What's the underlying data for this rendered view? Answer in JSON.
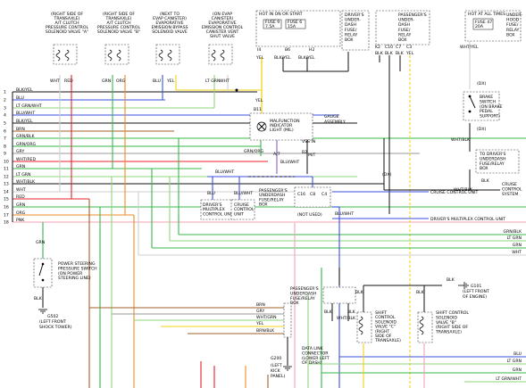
{
  "colors": {
    "red": "#e8202a",
    "yel": "#f2d214",
    "grn": "#36b84a",
    "blu": "#3a4fe0",
    "ltgrn": "#8fd67a",
    "brn": "#a0622a",
    "orange": "#f08a24",
    "pink": "#f2a2b4",
    "gray": "#9a9a9a",
    "wht": "#cfcfcf",
    "blk": "#111111",
    "purple": "#8a5fc8"
  },
  "top_components": [
    {
      "lines": [
        "(RIGHT SIDE OF",
        "TRANSAXLE)",
        "A/T CLUTCH",
        "PRESSURE CONTROL",
        "SOLENOID VALVE \"A\""
      ],
      "pins": [
        "WHT",
        "RED"
      ]
    },
    {
      "lines": [
        "(RIGHT SIDE OF",
        "TRANSAXLE)",
        "A/T CLUTCH",
        "PRESSURE CONTROL",
        "SOLENOID VALVE \"B\""
      ],
      "pins": [
        "GRN",
        "ORG"
      ]
    },
    {
      "lines": [
        "(NEXT TO",
        "EVAP CANISTER)",
        "EVAPORATIVE",
        "EMISSION BYPASS",
        "SOLENOID VALVE"
      ],
      "pins": [
        "BLU",
        "YEL"
      ]
    },
    {
      "lines": [
        "(ON EVAP",
        "CANISTER)",
        "EVAPORATIVE",
        "EMISSION CONTROL",
        "CANISTER VENT",
        "SHUT VALVE"
      ],
      "pins": [
        "LT GRN",
        "WHT"
      ]
    }
  ],
  "fuse_box_1": {
    "title": "HOT IN ON OR START",
    "fuse_a": [
      "FUSE 9",
      "7.5A"
    ],
    "fuse_b": [
      "FUSE 6",
      "15A"
    ],
    "wires": [
      "YEL",
      "BLK/YEL",
      "BLK/YEL"
    ],
    "connectors": [
      "I4",
      "B6",
      "H2"
    ]
  },
  "drivers_fuse_box": [
    "DRIVER'S",
    "UNDER-",
    "DASH",
    "FUSE/",
    "RELAY",
    "BOX"
  ],
  "passengers_fuse_box": {
    "lines": [
      "PASSENGER'S",
      "UNDER-",
      "DASH",
      "FUSE/",
      "RELAY",
      "BOX"
    ],
    "connectors": [
      "K2",
      "C10",
      "C7",
      "C3"
    ],
    "wires": [
      "BLK",
      "BLK",
      "BLK",
      "YEL"
    ]
  },
  "hot_at_all_times": {
    "title": "HOT AT ALL TIMES",
    "fuse": [
      "FUSE 47",
      "20A"
    ],
    "box_lines": [
      "UNDER-",
      "HOOD",
      "FUSE/",
      "RELAY",
      "BOX"
    ],
    "wires": [
      "WHT/YEL",
      "WHT/BLK"
    ]
  },
  "brake_switch": {
    "id": "(DX)",
    "lines": [
      "BRAKE",
      "SWITCH",
      "(ON BRAKE",
      "PEDAL",
      "SUPPORT)"
    ],
    "note": "(DX)",
    "wire": "WHT/BLK"
  },
  "drivers_underdash_right": [
    "TO DRIVER'S",
    "UNDERDASH",
    "FUSE/RELAY",
    "BOX"
  ],
  "cruise_control_system": [
    "CRUISE",
    "CONTROL",
    "SYSTEM"
  ],
  "left_wire_labels": [
    "BLK/YEL",
    "BLU",
    "LT GRN/WHT",
    "BLU/WHT",
    "BLK/YEL",
    "BRN",
    "GRN/BLK",
    "GRN/ORG",
    "GRY",
    "WHT/RED",
    "GRN",
    "LT GRN",
    "WHT/BLK",
    "WHT",
    "RED",
    "GRN",
    "ORG",
    "PNK"
  ],
  "left_pin_numbers": [
    "1",
    "2",
    "3",
    "4",
    "5",
    "6",
    "7",
    "8",
    "9",
    "10",
    "11",
    "12",
    "13",
    "14",
    "15",
    "16",
    "17",
    "18"
  ],
  "malfunction_indicator": {
    "lines": [
      "MALFUNCTION",
      "INDICATOR",
      "LIGHT (MIL)"
    ],
    "side_label": [
      "GAUGE",
      "ASSEMBLY"
    ],
    "top_wire": "YEL",
    "top_pin": "B11",
    "wire_left": "GRN/ORG",
    "wire_mid": "A/7",
    "vss_in": "VSS IN",
    "pin_b2": "B2"
  },
  "center_labels": {
    "blu_wht_1": "BLU/WHT",
    "blu_wht_2": "BLU/WHT",
    "blu": "BLU",
    "blu_wht_3": "BLU/WHT",
    "wht_blk": "WHT/BLK",
    "blk_label": "BLK",
    "mt": "M/T",
    "wht_blk_right": "WHT/BLK",
    "dx": "(DX)"
  },
  "drivers_multiplex_1": [
    "DRIVER'S",
    "MULTIPLEX",
    "CONTROL UNIT"
  ],
  "cruise_control_unit_1": [
    "CRUISE",
    "CONTROL",
    "UNIT"
  ],
  "passengers_fuse_mid": {
    "lines": [
      "PASSENGER'S",
      "UNDERDASH",
      "FUSE/RELAY",
      "BOX"
    ],
    "note": "(NOT USED)",
    "pins": [
      "C16",
      "C8",
      "C4"
    ]
  },
  "right_wire_labels": [
    {
      "label": "CRUISE CONTROL UNIT"
    },
    {
      "label": "DRIVER'S MULTIPLEX CONTROL UNIT"
    }
  ],
  "right_side_labels": [
    "GRN/BLK",
    "LT GRN",
    "GRN",
    "WHT"
  ],
  "power_steering": {
    "lines": [
      "POWER STEERING",
      "PRESSURE SWITCH",
      "(ON POWER",
      "STEERING LINE)"
    ],
    "wire": "GRN",
    "ground": "G502",
    "ground_lines": [
      "(LEFT FRONT",
      "SHOCK TOWER)"
    ],
    "wire_blk": "BLK"
  },
  "passengers_fuse_low": {
    "lines": [
      "PASSENGER'S",
      "UNDERDASH",
      "FUSE/RELAY",
      "BOX"
    ],
    "wires": [
      "BLK",
      "WHT/BLK",
      "BLK"
    ]
  },
  "data_link": {
    "wires": [
      "BRN",
      "GRY",
      "WHT/GRN",
      "YEL",
      "BRN/BLK"
    ],
    "lines": [
      "DATA LINK",
      "CONNECTOR",
      "(LOWER LEFT",
      "OF DASH)"
    ],
    "ground": "G200",
    "ground_lines": [
      "(LEFT",
      "KICK",
      "PANEL)"
    ]
  },
  "shift_c": {
    "lines": [
      "SHIFT",
      "CONTROL",
      "SOLENOID",
      "VALVE \"C\"",
      "(RIGHT",
      "SIDE OF",
      "TRANSAXLE)"
    ],
    "wire": "BLK"
  },
  "shift_b": {
    "lines": [
      "SHIFT CONTROL",
      "SOLENOID",
      "VALVE \"B\"",
      "(RIGHT SIDE OF",
      "TRANSAXLE)"
    ],
    "wire": "BLK"
  },
  "g101": {
    "name": "G101",
    "lines": [
      "(LEFT FRONT",
      "OF ENGINE)"
    ],
    "wire": "BLK"
  },
  "bottom_right_labels": [
    "BLU",
    "LT GRN",
    "GRN",
    "LT GRN/WHT"
  ]
}
